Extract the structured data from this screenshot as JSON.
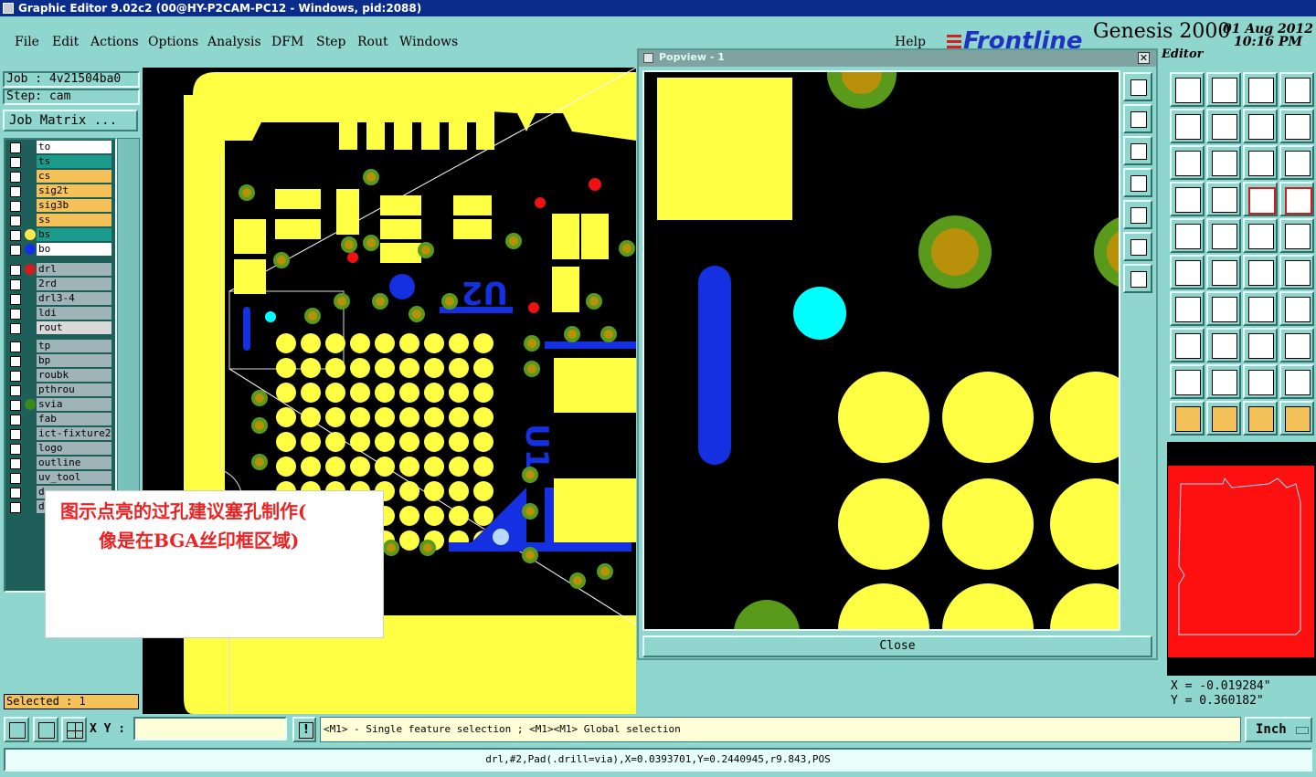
{
  "window": {
    "title": "Graphic Editor 9.02c2 (00@HY-P2CAM-PC12 - Windows, pid:2088)"
  },
  "menu": [
    "File",
    "Edit",
    "Actions",
    "Options",
    "Analysis",
    "DFM",
    "Step",
    "Rout",
    "Windows"
  ],
  "help_label": "Help",
  "brand": {
    "logo_text": "Frontline",
    "product": "Genesis 2000",
    "date": "01 Aug 2012",
    "time": "10:16 PM",
    "mode": "Editor"
  },
  "job": {
    "job_line": "Job : 4v21504ba0",
    "step_line": "Step: cam",
    "matrix_button": "Job Matrix ..."
  },
  "layers_board": [
    {
      "name": "to",
      "color": "#ffffff",
      "indicator": ""
    },
    {
      "name": "ts",
      "color": "#1c9a8c",
      "indicator": ""
    },
    {
      "name": "cs",
      "color": "#f5c25a",
      "indicator": ""
    },
    {
      "name": "sig2t",
      "color": "#f5c25a",
      "indicator": ""
    },
    {
      "name": "sig3b",
      "color": "#f5c25a",
      "indicator": ""
    },
    {
      "name": "ss",
      "color": "#f5c25a",
      "indicator": ""
    },
    {
      "name": "bs",
      "color": "#1c9a8c",
      "indicator": "#ffe94a"
    },
    {
      "name": "bo",
      "color": "#ffffff",
      "indicator": "#1530e0"
    }
  ],
  "layers_drill": [
    {
      "name": "drl",
      "color": "#9fb4b8",
      "indicator": "#d41c1c"
    },
    {
      "name": "2rd",
      "color": "#9fb4b8",
      "indicator": ""
    },
    {
      "name": "drl3-4",
      "color": "#9fb4b8",
      "indicator": ""
    },
    {
      "name": "ldi",
      "color": "#9fb4b8",
      "indicator": ""
    },
    {
      "name": "rout",
      "color": "#d9d9d9",
      "indicator": ""
    }
  ],
  "layers_other": [
    {
      "name": "tp",
      "color": "#9fb4b8",
      "indicator": ""
    },
    {
      "name": "bp",
      "color": "#9fb4b8",
      "indicator": ""
    },
    {
      "name": "roubk",
      "color": "#9fb4b8",
      "indicator": ""
    },
    {
      "name": "pthrou",
      "color": "#9fb4b8",
      "indicator": ""
    },
    {
      "name": "svia",
      "color": "#9fb4b8",
      "indicator": "#3a8a1a"
    },
    {
      "name": "fab",
      "color": "#9fb4b8",
      "indicator": ""
    },
    {
      "name": "ict-fixture2",
      "color": "#9fb4b8",
      "indicator": ""
    },
    {
      "name": "logo",
      "color": "#9fb4b8",
      "indicator": ""
    },
    {
      "name": "outline",
      "color": "#9fb4b8",
      "indicator": ""
    },
    {
      "name": "uv_tool",
      "color": "#9fb4b8",
      "indicator": ""
    },
    {
      "name": "d",
      "color": "#9fb4b8",
      "indicator": ""
    },
    {
      "name": "d",
      "color": "#9fb4b8",
      "indicator": ""
    }
  ],
  "selected_label": "Selected : 1",
  "annotation": {
    "line1": "图示点亮的过孔建议塞孔制作(",
    "line2": "像是在BGA丝印框区域)"
  },
  "popview": {
    "title": "Popview - 1",
    "close_button": "Close"
  },
  "coords": {
    "x": "X = -0.019284\"",
    "y": "Y = 0.360182\""
  },
  "bottom": {
    "xy_label": "X Y :",
    "xy_value": "",
    "hint": "<M1> - Single feature selection ; <M1><M1> Global selection",
    "units": "Inch"
  },
  "status_line": "drl,#2,Pad(.drill=via),X=0.0393701,Y=0.2440945,r9.843,POS",
  "tools": [
    "up-arrow-icon",
    "down-arrow-icon",
    "home-icon",
    "window-icon",
    "left-arrow-icon",
    "right-arrow-icon",
    "zoom-back-icon",
    "redraw-icon",
    "zoom-fit-icon",
    "pan-icon",
    "ratio-icon",
    "help-icon",
    "measure-icon",
    "grid-icon",
    "snap-icon",
    "snap-active-icon",
    "pad-select-icon",
    "shape-icon",
    "ruler-icon",
    "dot-icon",
    "net-icon",
    "cross-icon",
    "line-select-icon",
    "node-icon",
    "angle-icon",
    "slash-icon",
    "arc-icon",
    "ff-icon",
    "move-pad-icon",
    "minus-icon",
    "box-icon",
    "multi-icon",
    "tri-icon",
    "tri2-icon",
    "tri3-icon",
    "tri4-icon",
    "pointer-icon",
    "pointer2-icon",
    "pointer3-icon",
    "route-icon"
  ],
  "popview_tools": [
    "copy-icon",
    "upload-icon",
    "download-icon",
    "import-icon",
    "export-icon",
    "fit-icon",
    "expand-icon"
  ]
}
